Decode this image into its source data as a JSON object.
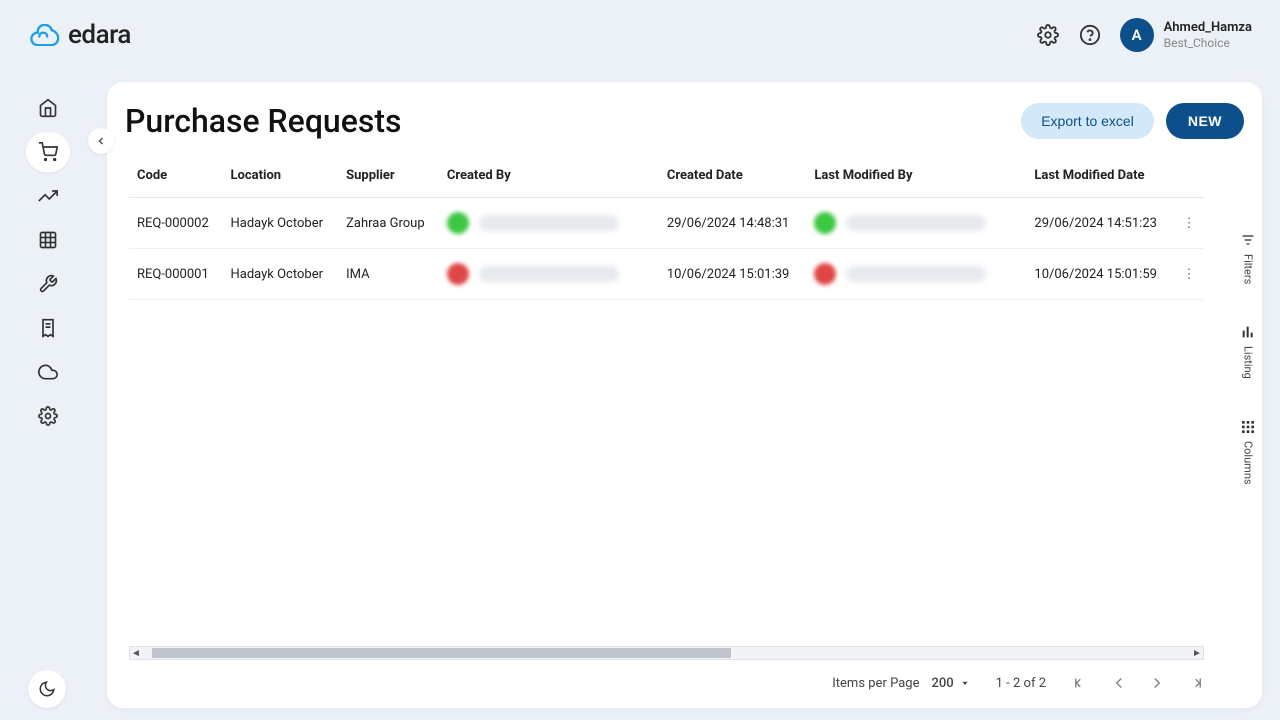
{
  "brand": {
    "name": "edara"
  },
  "user": {
    "initial": "A",
    "name": "Ahmed_Hamza",
    "org": "Best_Choice"
  },
  "sidebar": {
    "items": [
      {
        "name": "home"
      },
      {
        "name": "cart",
        "active": true
      },
      {
        "name": "trend"
      },
      {
        "name": "grid"
      },
      {
        "name": "wrench"
      },
      {
        "name": "receipt"
      },
      {
        "name": "cloud"
      },
      {
        "name": "settings"
      }
    ]
  },
  "page": {
    "title": "Purchase Requests",
    "export_label": "Export to excel",
    "new_label": "NEW"
  },
  "table": {
    "columns": [
      "Code",
      "Location",
      "Supplier",
      "Created By",
      "Created Date",
      "Last Modified By",
      "Last Modified Date"
    ],
    "rows": [
      {
        "code": "REQ-000002",
        "location": "Hadayk October",
        "supplier": "Zahraa Group",
        "created_by_color": "green",
        "created_date": "29/06/2024  14:48:31",
        "modified_by_color": "green",
        "modified_date": "29/06/2024  14:51:23"
      },
      {
        "code": "REQ-000001",
        "location": "Hadayk October",
        "supplier": "IMA",
        "created_by_color": "red",
        "created_date": "10/06/2024  15:01:39",
        "modified_by_color": "red",
        "modified_date": "10/06/2024  15:01:59"
      }
    ]
  },
  "side_tools": {
    "filters": "Filters",
    "listing": "Listing",
    "columns": "Columns"
  },
  "pager": {
    "ipp_label": "Items per Page",
    "ipp_value": "200",
    "range": "1 - 2 of 2"
  }
}
